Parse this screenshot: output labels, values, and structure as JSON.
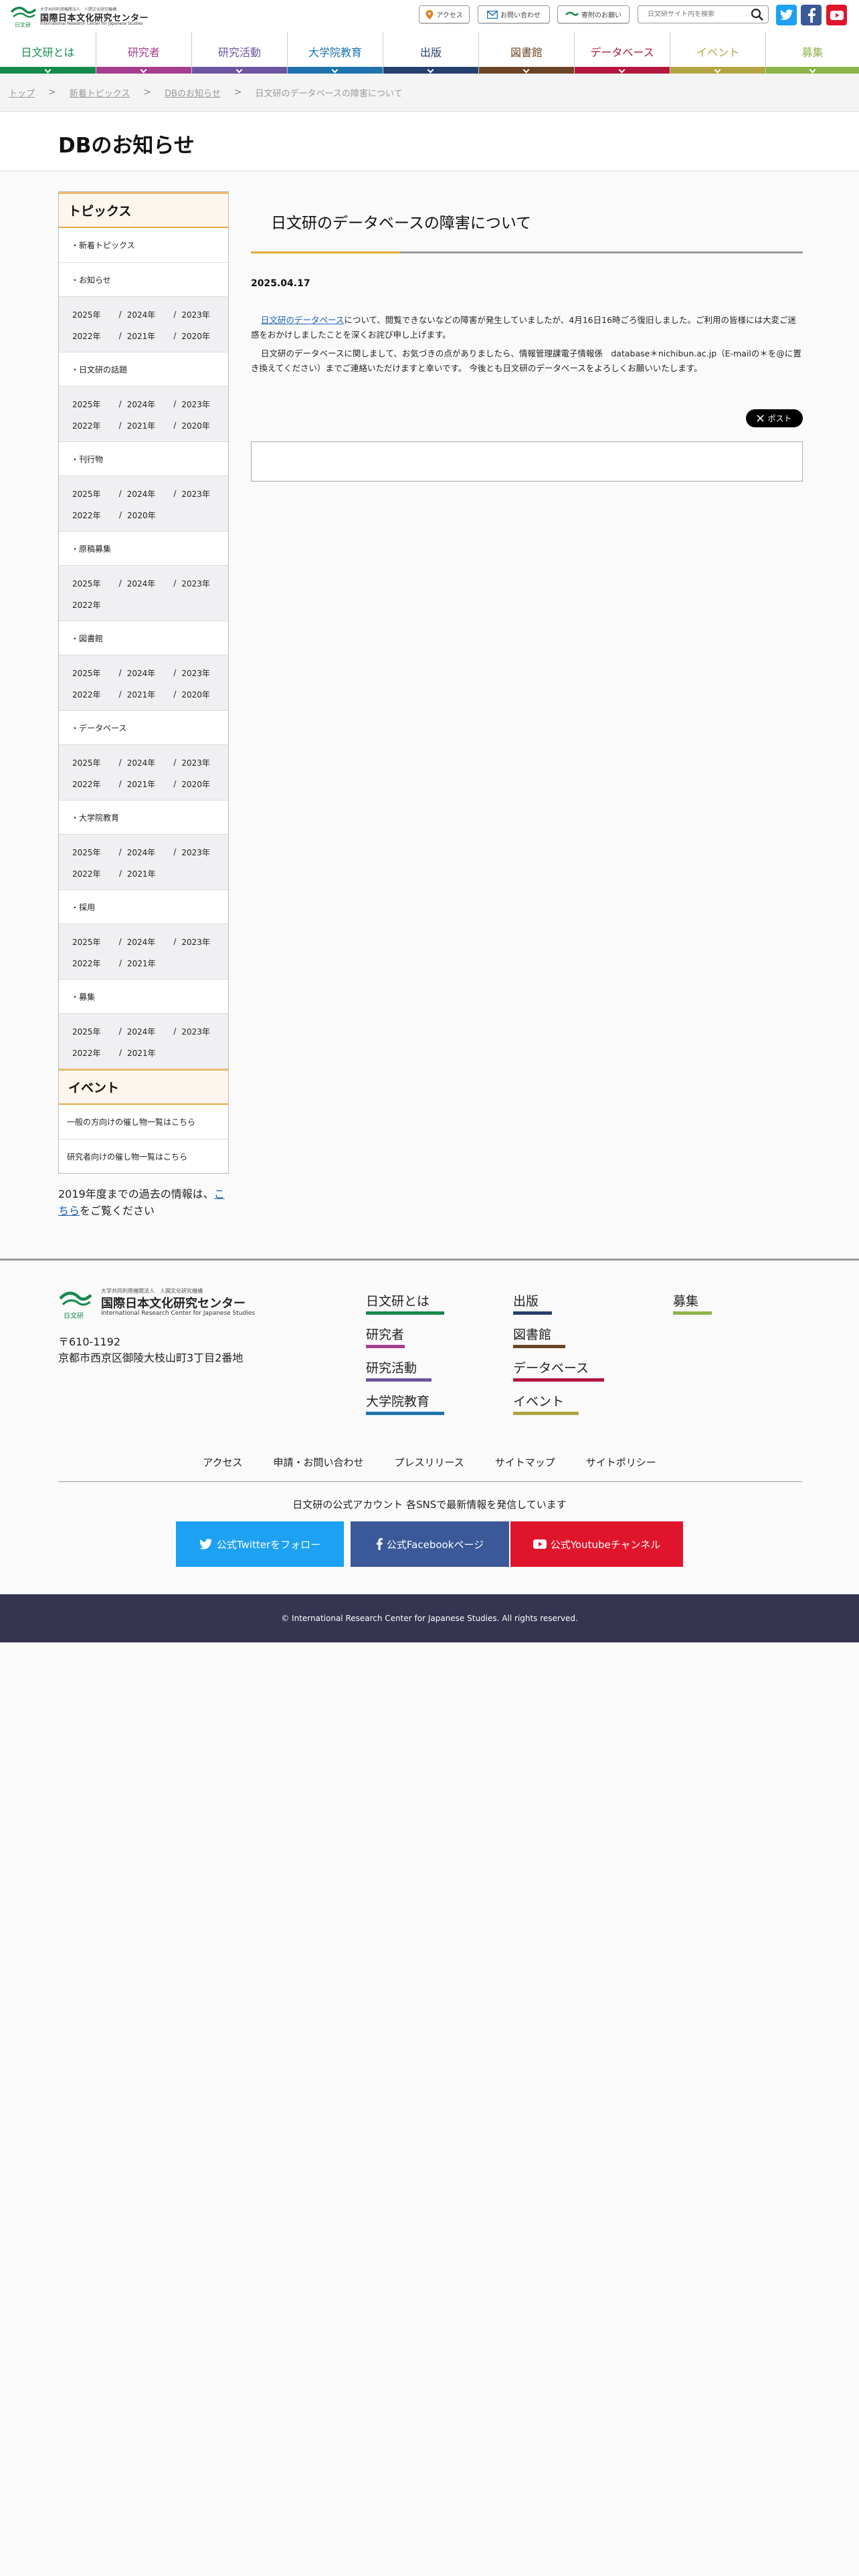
{
  "header": {
    "logo_small": "大学共同利用機関法人　人間文化研究機構",
    "logo_main": "国際日本文化研究センター",
    "logo_en": "International Research Center for Japanese Studies",
    "logo_sub": "日文研",
    "util": {
      "access": "アクセス",
      "contact": "お問い合わせ",
      "donation": "寄附のお願い"
    },
    "search_placeholder": "日文研サイト内を検索"
  },
  "nav": [
    {
      "label": "日文研とは",
      "color": "#138a4a"
    },
    {
      "label": "研究者",
      "color": "#a63d8f"
    },
    {
      "label": "研究活動",
      "color": "#6b54a0"
    },
    {
      "label": "大学院教育",
      "color": "#1e73ad"
    },
    {
      "label": "出版",
      "color": "#26406e"
    },
    {
      "label": "図書館",
      "color": "#6b4525"
    },
    {
      "label": "データベース",
      "color": "#b5163f"
    },
    {
      "label": "イベント",
      "color": "#b2a542"
    },
    {
      "label": "募集",
      "color": "#8bb44a"
    }
  ],
  "breadcrumb": {
    "top": "トップ",
    "news": "新着トピックス",
    "db": "DBのお知らせ",
    "current": "日文研のデータベースの障害について"
  },
  "page_title": "DBのお知らせ",
  "sidebar": {
    "topics_head": "トピックス",
    "cat_latest": "・新着トピックス",
    "cat_notice": "・お知らせ",
    "notice_years": [
      [
        "2025年",
        "2024年",
        "2023年"
      ],
      [
        "2022年",
        "2021年",
        "2020年"
      ]
    ],
    "cat_topic": "・日文研の話題",
    "topic_years": [
      [
        "2025年",
        "2024年",
        "2023年"
      ],
      [
        "2022年",
        "2021年",
        "2020年"
      ]
    ],
    "cat_pub": "・刊行物",
    "pub_years": [
      [
        "2025年",
        "2024年",
        "2023年"
      ],
      [
        "2022年",
        "2020年"
      ]
    ],
    "cat_manu": "・原稿募集",
    "manu_years": [
      [
        "2025年",
        "2024年",
        "2023年"
      ],
      [
        "2022年"
      ]
    ],
    "cat_lib": "・図書館",
    "lib_years": [
      [
        "2025年",
        "2024年",
        "2023年"
      ],
      [
        "2022年",
        "2021年",
        "2020年"
      ]
    ],
    "cat_db": "・データベース",
    "db_years": [
      [
        "2025年",
        "2024年",
        "2023年"
      ],
      [
        "2022年",
        "2021年",
        "2020年"
      ]
    ],
    "cat_grad": "・大学院教育",
    "grad_years": [
      [
        "2025年",
        "2024年",
        "2023年"
      ],
      [
        "2022年",
        "2021年"
      ]
    ],
    "cat_hire": "・採用",
    "hire_years": [
      [
        "2025年",
        "2024年",
        "2023年"
      ],
      [
        "2022年",
        "2021年"
      ]
    ],
    "cat_recruit": "・募集",
    "recruit_years": [
      [
        "2025年",
        "2024年",
        "2023年"
      ],
      [
        "2022年",
        "2021年"
      ]
    ],
    "event_head": "イベント",
    "event_general": "一般の方向けの催し物一覧はこちら",
    "event_research": "研究者向けの催し物一覧はこちら",
    "note_pre": "2019年度までの過去の情報は、",
    "note_link": "こちら",
    "note_post": "をご覧ください"
  },
  "article": {
    "title": "日文研のデータベースの障害について",
    "date": "2025.04.17",
    "p1_link": "日文研のデータベース",
    "p1_rest": "について、閲覧できないなどの障害が発生していましたが、4月16日16時ごろ復旧しました。ご利用の皆様には大変ご迷惑をおかけしましたことを深くお詫び申し上げます。",
    "p2": "日文研のデータベースに関しまして、お気づきの点がありましたら、情報管理課電子情報係　database＊nichibun.ac.jp（E-mailの＊を@に置き換えてください）までご連絡いただけますと幸いです。 今後とも日文研のデータベースをよろしくお願いいたします。",
    "post_label": "ポスト"
  },
  "footer": {
    "logo_small": "大学共同利用機関法人　人間文化研究機構",
    "logo_main": "国際日本文化研究センター",
    "logo_en": "International Research Center for Japanese Studies",
    "logo_sub": "日文研",
    "postal": "〒610-1192",
    "address": "京都市西京区御陵大枝山町3丁目2番地",
    "links": {
      "about": "日文研とは",
      "researchers": "研究者",
      "activities": "研究活動",
      "graduate": "大学院教育",
      "publish": "出版",
      "library": "図書館",
      "database": "データベース",
      "event": "イベント",
      "recruit": "募集"
    },
    "sub": {
      "access": "アクセス",
      "contact": "申請・お問い合わせ",
      "press": "プレスリリース",
      "sitemap": "サイトマップ",
      "policy": "サイトポリシー"
    },
    "sns_text": "日文研の公式アカウント 各SNSで最新情報を発信しています",
    "twitter": "公式Twitterをフォロー",
    "facebook": "公式Facebookページ",
    "youtube": "公式Youtubeチャンネル",
    "copyright": "© International Research Center for Japanese Studies. All rights reserved."
  },
  "colors": {
    "twitter": "#1da1f2",
    "facebook": "#3b5998",
    "youtube": "#e0152c",
    "footer_bar": "#353451",
    "accent": "#e2a93b"
  }
}
